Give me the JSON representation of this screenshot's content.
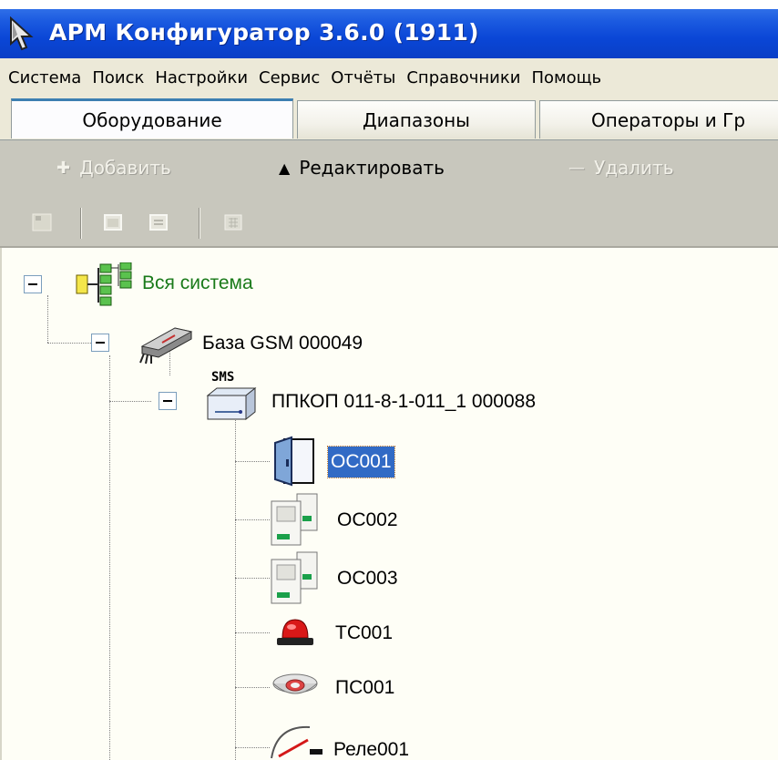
{
  "window": {
    "title": "АРМ Конфигуратор  3.6.0 (1911)"
  },
  "menu": {
    "items": [
      "Система",
      "Поиск",
      "Настройки",
      "Сервис",
      "Отчёты",
      "Справочники",
      "Помощь"
    ]
  },
  "tabs": [
    {
      "label": "Оборудование",
      "active": true
    },
    {
      "label": "Диапазоны",
      "active": false
    },
    {
      "label": "Операторы и Гр",
      "active": false
    }
  ],
  "actions": {
    "add_label": "Добавить",
    "edit_label": "Редактировать",
    "delete_label": "Удалить"
  },
  "tree": {
    "root": {
      "label": "Вся система",
      "icon": "network-tree-icon"
    },
    "base": {
      "label": "База GSM 000049",
      "icon": "gsm-modem-icon"
    },
    "panel": {
      "label": "ППКОП 011-8-1-011_1 000088",
      "icon": "sms-panel-icon",
      "badge": "SMS"
    },
    "children": [
      {
        "label": "ОС001",
        "icon": "door-sensor-icon",
        "selected": true
      },
      {
        "label": "ОС002",
        "icon": "motion-sensor-icon",
        "selected": false
      },
      {
        "label": "ОС003",
        "icon": "motion-sensor-icon",
        "selected": false
      },
      {
        "label": "ТС001",
        "icon": "alarm-light-icon",
        "selected": false
      },
      {
        "label": "ПС001",
        "icon": "smoke-detector-icon",
        "selected": false
      },
      {
        "label": "Реле001",
        "icon": "relay-icon",
        "selected": false
      }
    ]
  },
  "colors": {
    "titlebar": "#0a46d6",
    "selection": "#316ac5",
    "root_label": "#1a7a1a",
    "toolbar_bg": "#c8c7bd"
  }
}
